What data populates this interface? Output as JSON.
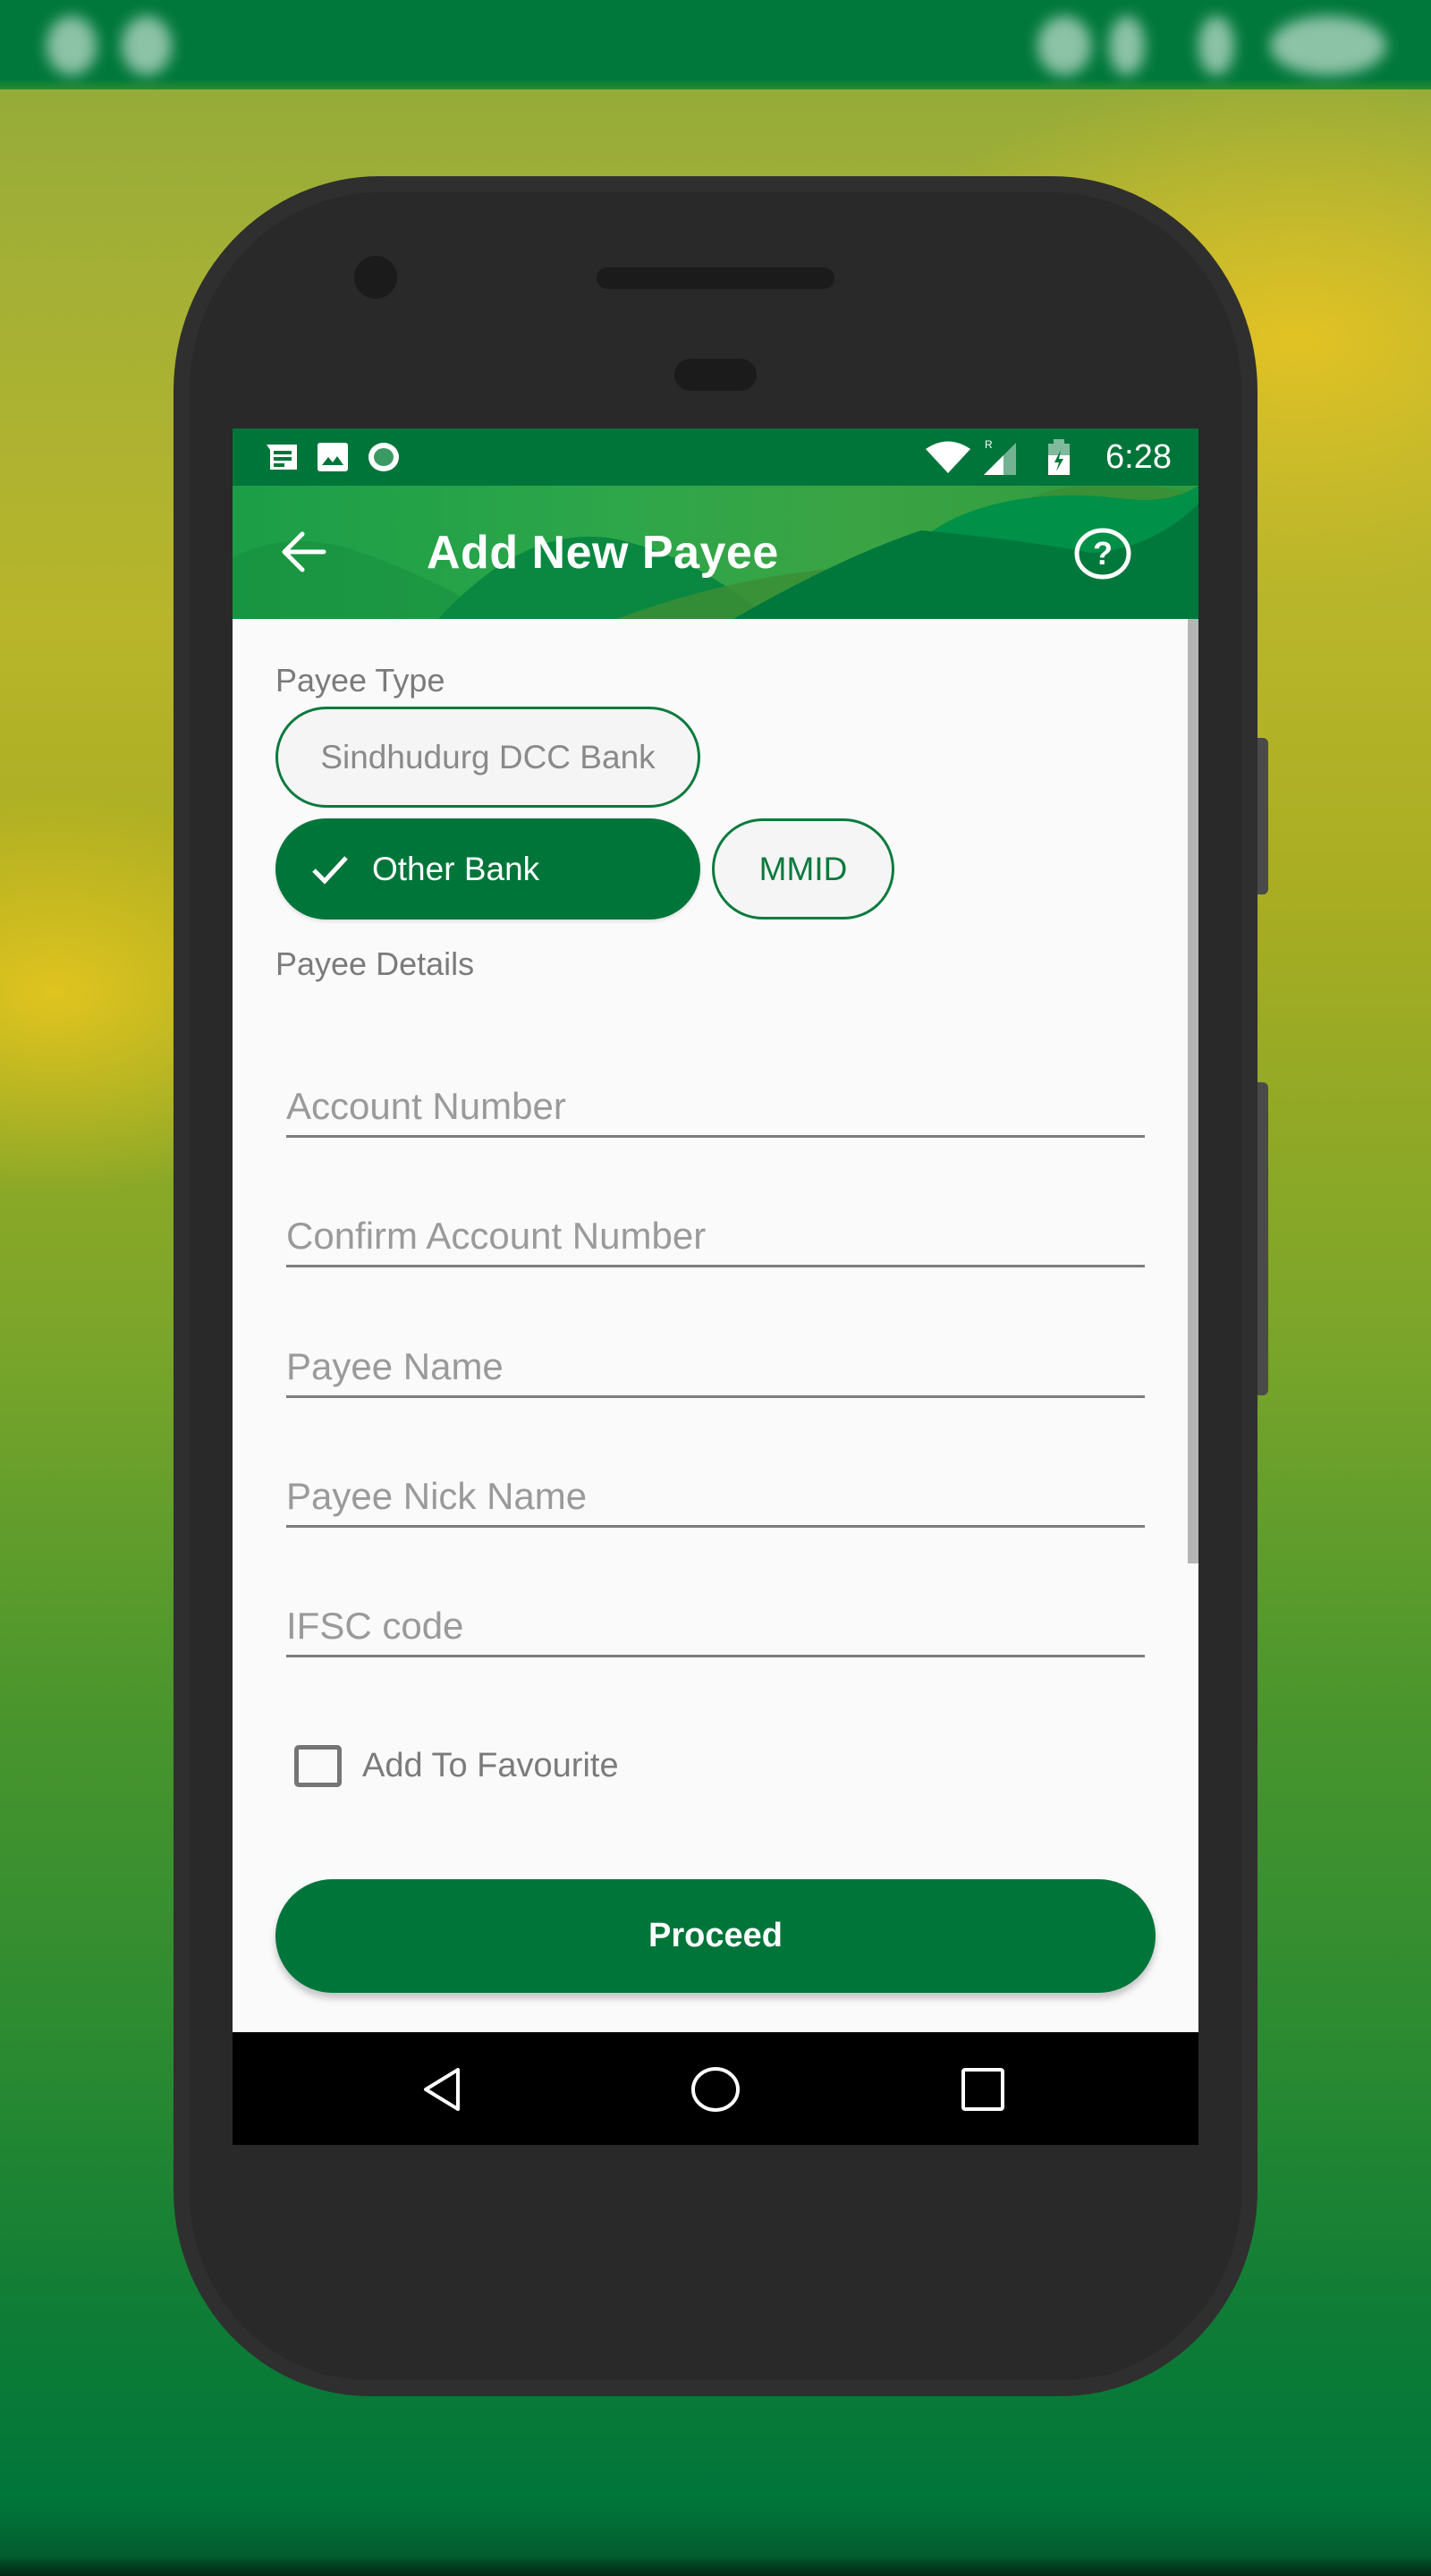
{
  "device_status_bar": {
    "time": "6:28"
  },
  "status_bar": {
    "left_icons": [
      "message-icon",
      "image-icon",
      "record-icon"
    ],
    "right_icons": [
      "wifi-icon",
      "signal-roaming-icon",
      "battery-charging-icon"
    ],
    "roaming_label": "R",
    "time": "6:28"
  },
  "app_bar": {
    "title": "Add New Payee",
    "back_icon": "arrow-left-icon",
    "help_icon": "help-circle-icon"
  },
  "payee_type": {
    "label": "Payee Type",
    "options": [
      {
        "label": "Sindhudurg DCC Bank",
        "selected": false
      },
      {
        "label": "Other Bank",
        "selected": true
      },
      {
        "label": "MMID",
        "selected": false
      }
    ]
  },
  "payee_details": {
    "label": "Payee Details",
    "fields": [
      {
        "placeholder": "Account Number",
        "value": ""
      },
      {
        "placeholder": "Confirm Account Number",
        "value": ""
      },
      {
        "placeholder": "Payee Name",
        "value": ""
      },
      {
        "placeholder": "Payee Nick Name",
        "value": ""
      },
      {
        "placeholder": "IFSC code",
        "value": ""
      }
    ]
  },
  "favourite": {
    "label": "Add To Favourite",
    "checked": false
  },
  "actions": {
    "proceed_label": "Proceed"
  },
  "nav_bar": {
    "icons": [
      "back-triangle-icon",
      "home-circle-icon",
      "recents-square-icon"
    ]
  },
  "colors": {
    "brand_green": "#00753a",
    "chip_outline": "#0b7a3d",
    "label_gray": "#7b7b7b",
    "placeholder_gray": "#9a9a9a"
  }
}
